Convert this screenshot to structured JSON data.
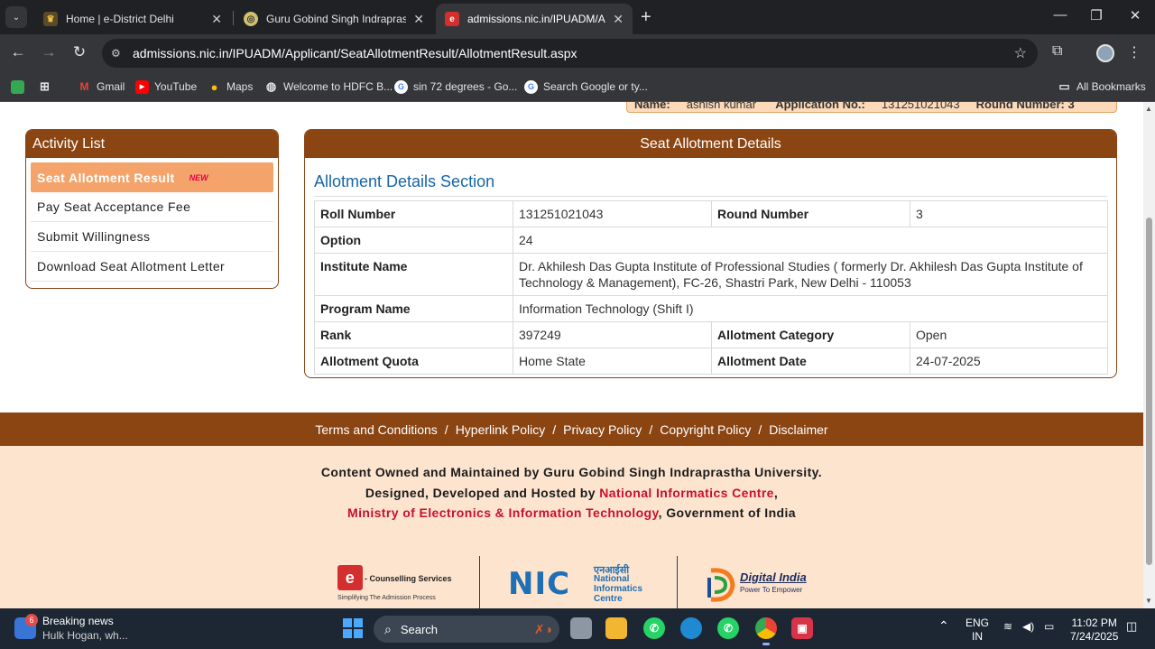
{
  "browser": {
    "tabs": [
      {
        "title": "Home | e-District Delhi",
        "active": false
      },
      {
        "title": "Guru Gobind Singh Indraprastha",
        "active": false
      },
      {
        "title": "admissions.nic.in/IPUADM/Appl",
        "active": true
      }
    ],
    "new_tab_icon": "plus-icon",
    "url": "admissions.nic.in/IPUADM/Applicant/SeatAllotmentResult/AllotmentResult.aspx",
    "bookmarks": [
      {
        "label": "Gmail",
        "icon": "gmail-icon"
      },
      {
        "label": "YouTube",
        "icon": "youtube-icon"
      },
      {
        "label": "Maps",
        "icon": "maps-icon"
      },
      {
        "label": "Welcome to HDFC B...",
        "icon": "globe-icon"
      },
      {
        "label": "sin 72 degrees - Go...",
        "icon": "google-icon"
      },
      {
        "label": "Search Google or ty...",
        "icon": "google-icon"
      }
    ],
    "all_bookmarks": "All Bookmarks"
  },
  "top_strip": {
    "name_label": "Name:",
    "name_value": "ashish kumar",
    "appno_label": "Application No.:",
    "appno_value": "131251021043",
    "round_label": "Round Number: 3"
  },
  "activity": {
    "title": "Activity List",
    "new_badge": "NEW",
    "items": [
      "Seat Allotment Result",
      "Pay Seat Acceptance Fee",
      "Submit Willingness",
      "Download Seat Allotment Letter"
    ]
  },
  "seat": {
    "title": "Seat Allotment Details",
    "section_title": "Allotment Details Section",
    "roll_label": "Roll Number",
    "roll_value": "131251021043",
    "round_label": "Round Number",
    "round_value": "3",
    "option_label": "Option",
    "option_value": "24",
    "institute_label": "Institute Name",
    "institute_value": "Dr. Akhilesh Das Gupta Institute of Professional Studies ( formerly Dr. Akhilesh Das Gupta Institute of Technology & Management), FC-26, Shastri Park, New Delhi - 110053",
    "program_label": "Program Name",
    "program_value": "Information Technology (Shift I)",
    "rank_label": "Rank",
    "rank_value": "397249",
    "category_label": "Allotment Category",
    "category_value": "Open",
    "quota_label": "Allotment Quota",
    "quota_value": "Home State",
    "date_label": "Allotment Date",
    "date_value": "24-07-2025"
  },
  "footer": {
    "links": [
      "Terms and Conditions",
      "Hyperlink Policy",
      "Privacy Policy",
      "Copyright Policy",
      "Disclaimer"
    ],
    "separator": "/",
    "line1": "Content Owned and Maintained by Guru Gobind Singh Indraprastha University.",
    "line2_prefix": "Designed, Developed and Hosted by ",
    "line2_link": "National Informatics Centre",
    "line2_suffix": ",",
    "line3_link": "Ministry of Electronics & Information Technology",
    "line3_suffix": ", Government of India",
    "logo1_title": "- Counselling Services",
    "logo1_sub": "Simplifying The Admission Process",
    "logo2_hindi": "एनआईसी",
    "logo2_lines": [
      "National",
      "Informatics",
      "Centre"
    ],
    "logo3_title": "Digital India",
    "logo3_sub": "Power To Empower"
  },
  "taskbar": {
    "news_title": "Breaking news",
    "news_sub": "Hulk Hogan, wh...",
    "news_badge": "6",
    "search": "Search",
    "lang1": "ENG",
    "lang2": "IN",
    "time": "11:02 PM",
    "date": "7/24/2025"
  },
  "colors": {
    "brown": "#8b4513",
    "active_item": "#f4a46a",
    "section_blue": "#1565a8",
    "footer_bg": "#fde4cf",
    "footer_red": "#c8102e"
  }
}
